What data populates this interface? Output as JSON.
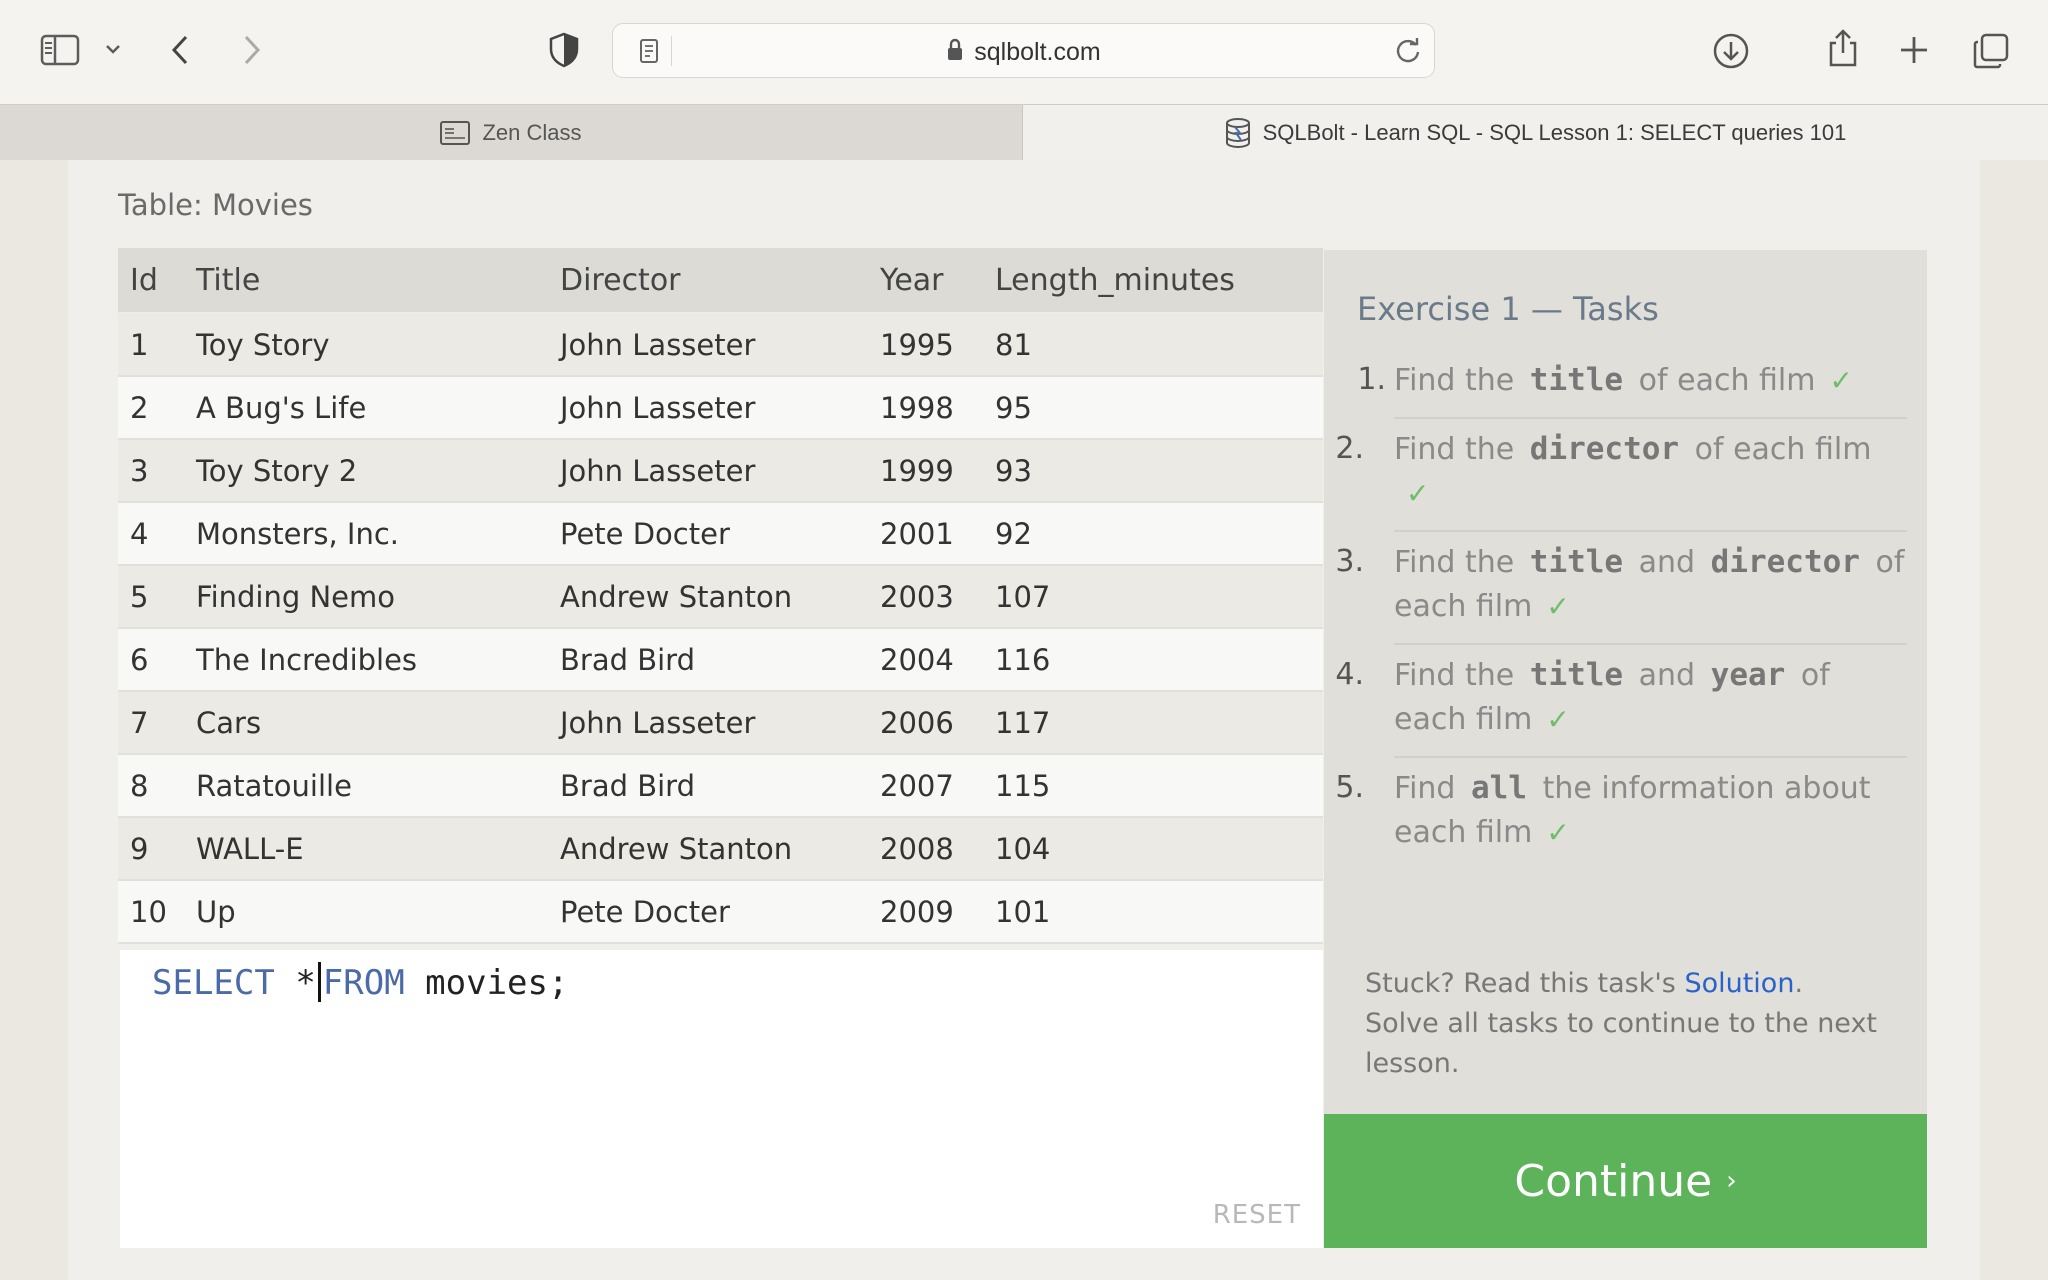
{
  "browser": {
    "url": "sqlbolt.com",
    "tabs": [
      {
        "label": "Zen Class",
        "active": false,
        "icon": "zen-class-icon"
      },
      {
        "label": "SQLBolt - Learn SQL - SQL Lesson 1: SELECT queries 101",
        "active": true,
        "icon": "database-icon"
      }
    ]
  },
  "table": {
    "title": "Table: Movies",
    "columns": [
      "Id",
      "Title",
      "Director",
      "Year",
      "Length_minutes"
    ],
    "rows": [
      [
        "1",
        "Toy Story",
        "John Lasseter",
        "1995",
        "81"
      ],
      [
        "2",
        "A Bug's Life",
        "John Lasseter",
        "1998",
        "95"
      ],
      [
        "3",
        "Toy Story 2",
        "John Lasseter",
        "1999",
        "93"
      ],
      [
        "4",
        "Monsters, Inc.",
        "Pete Docter",
        "2001",
        "92"
      ],
      [
        "5",
        "Finding Nemo",
        "Andrew Stanton",
        "2003",
        "107"
      ],
      [
        "6",
        "The Incredibles",
        "Brad Bird",
        "2004",
        "116"
      ],
      [
        "7",
        "Cars",
        "John Lasseter",
        "2006",
        "117"
      ],
      [
        "8",
        "Ratatouille",
        "Brad Bird",
        "2007",
        "115"
      ],
      [
        "9",
        "WALL-E",
        "Andrew Stanton",
        "2008",
        "104"
      ],
      [
        "10",
        "Up",
        "Pete Docter",
        "2009",
        "101"
      ]
    ]
  },
  "editor": {
    "kw_select": "SELECT",
    "star": "*",
    "kw_from": "FROM",
    "rest": "movies;",
    "reset_label": "RESET"
  },
  "tasks": {
    "title": "Exercise 1 — Tasks",
    "items": [
      {
        "num": "1.",
        "parts": [
          "Find the",
          "title",
          "of each film"
        ],
        "done": true
      },
      {
        "num": "2.",
        "parts": [
          "Find the",
          "director",
          "of each film"
        ],
        "done": true
      },
      {
        "num": "3.",
        "parts": [
          "Find the",
          "title",
          "and",
          "director",
          "of each film"
        ],
        "done": true
      },
      {
        "num": "4.",
        "parts": [
          "Find the",
          "title",
          "and",
          "year",
          "of each film"
        ],
        "done": true
      },
      {
        "num": "5.",
        "parts": [
          "Find",
          "all",
          "the information about each film"
        ],
        "done": true
      }
    ],
    "check": "✓",
    "stuck_prefix": "Stuck? Read this task's",
    "solution_link": "Solution",
    "stuck_suffix": ".",
    "solve_note": "Solve all tasks to continue to the next lesson."
  },
  "continue": {
    "label": "Continue",
    "chevron": "›"
  },
  "colors": {
    "continue_bg": "#5db35a",
    "keyword": "#4a6aa8",
    "check": "#6ebd6a",
    "link": "#2a62c9"
  }
}
